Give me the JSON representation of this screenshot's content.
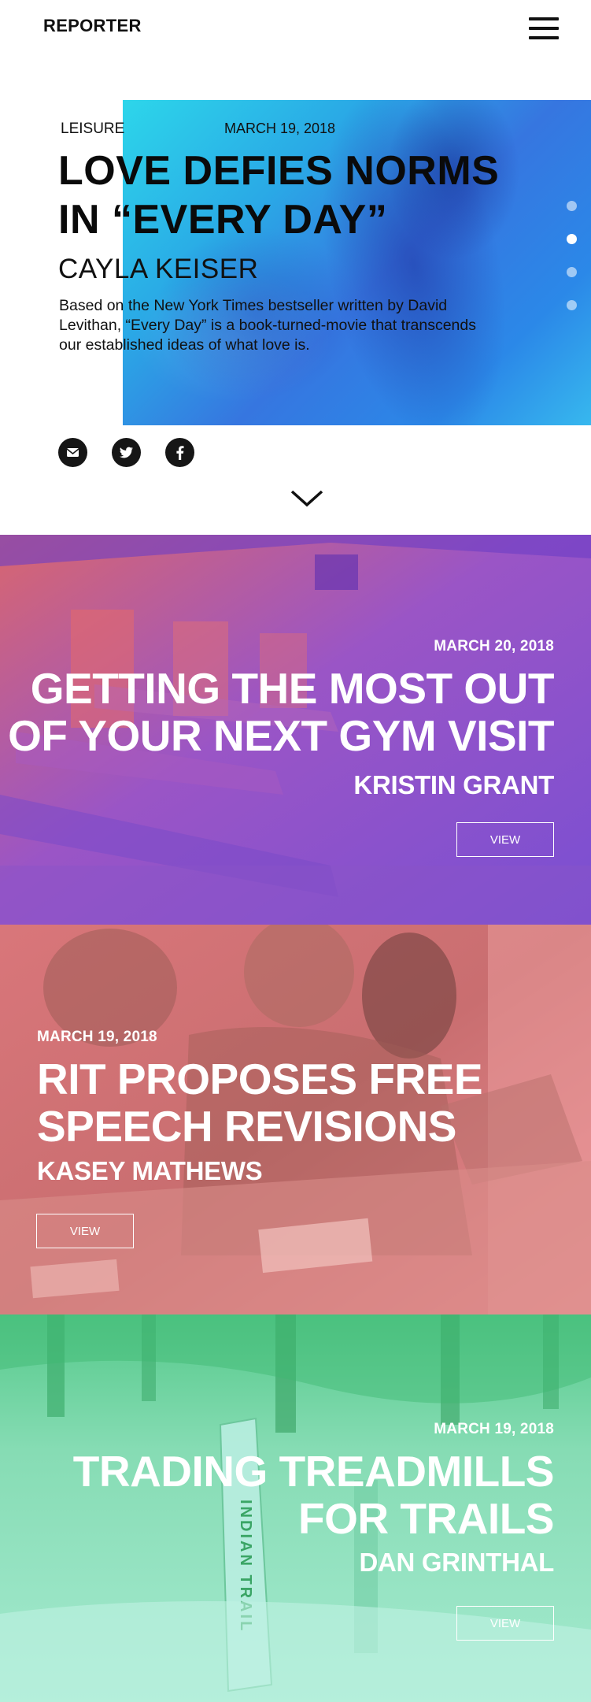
{
  "header": {
    "brand": "REPORTER",
    "menu_icon": "hamburger-icon"
  },
  "hero": {
    "category": "LEISURE",
    "date": "MARCH 19, 2018",
    "title_line1": "LOVE DEFIES NORMS",
    "title_line2": "IN “EVERY DAY”",
    "author": "CAYLA KEISER",
    "summary": "Based on the New York Times bestseller written by David Levithan, “Every Day” is a book-turned-movie that transcends our established ideas of what love is.",
    "slides": 4,
    "active_slide": 2,
    "share": [
      "email-icon",
      "twitter-icon",
      "facebook-icon"
    ],
    "scroll_icon": "chevron-down-icon"
  },
  "stories": [
    {
      "date": "MARCH 20, 2018",
      "title_line1": "GETTING THE MOST OUT",
      "title_line2": "OF YOUR NEXT GYM VISIT",
      "author": "KRISTIN GRANT",
      "button": "VIEW",
      "tint": "#7b4fd0",
      "accent": "#e06a6f"
    },
    {
      "date": "MARCH 19, 2018",
      "title_line1": "RIT PROPOSES FREE",
      "title_line2": "SPEECH REVISIONS",
      "author": "KASEY MATHEWS",
      "button": "VIEW",
      "tint": "#e37a7c",
      "accent": "#8a5a52"
    },
    {
      "date": "MARCH 19, 2018",
      "title_line1": "TRADING TREADMILLS",
      "title_line2": "FOR TRAILS",
      "author": "DAN GRINTHAL",
      "button": "VIEW",
      "tint": "#8fe0bd",
      "accent": "#3fb874"
    }
  ]
}
